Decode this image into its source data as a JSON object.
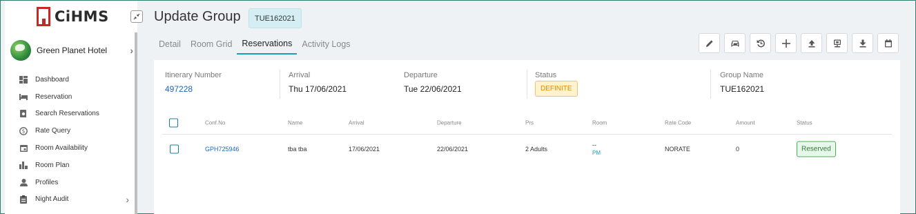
{
  "app": {
    "logo_text": "CiHMS"
  },
  "sidebar": {
    "hotel_name": "Green Planet Hotel",
    "items": [
      {
        "label": "Dashboard",
        "icon": "dashboard-icon"
      },
      {
        "label": "Reservation",
        "icon": "bed-icon"
      },
      {
        "label": "Search Reservations",
        "icon": "search-icon"
      },
      {
        "label": "Rate Query",
        "icon": "dollar-icon"
      },
      {
        "label": "Room Availability",
        "icon": "calendar-icon"
      },
      {
        "label": "Room Plan",
        "icon": "bar-chart-icon"
      },
      {
        "label": "Profiles",
        "icon": "person-icon"
      },
      {
        "label": "Night Audit",
        "icon": "clipboard-icon",
        "has_submenu": true
      }
    ]
  },
  "header": {
    "title": "Update Group",
    "group_code": "TUE162021"
  },
  "tabs": [
    {
      "label": "Detail",
      "active": false
    },
    {
      "label": "Room Grid",
      "active": false
    },
    {
      "label": "Reservations",
      "active": true
    },
    {
      "label": "Activity Logs",
      "active": false
    }
  ],
  "toolbar": [
    {
      "icon": "pencil-icon"
    },
    {
      "icon": "car-icon"
    },
    {
      "icon": "history-icon"
    },
    {
      "icon": "plus-icon"
    },
    {
      "icon": "upload-icon"
    },
    {
      "icon": "monitor-icon"
    },
    {
      "icon": "download-icon"
    },
    {
      "icon": "calendar-icon"
    }
  ],
  "summary": {
    "itinerary_label": "Itinerary Number",
    "itinerary_value": "497228",
    "arrival_label": "Arrival",
    "arrival_value": "Thu 17/06/2021",
    "departure_label": "Departure",
    "departure_value": "Tue 22/06/2021",
    "status_label": "Status",
    "status_value": "DEFINITE",
    "group_name_label": "Group Name",
    "group_name_value": "TUE162021"
  },
  "table": {
    "columns": [
      "Conf.No",
      "Name",
      "Arrival",
      "Departure",
      "Prs",
      "Room",
      "Rate Code",
      "Amount",
      "Status"
    ],
    "rows": [
      {
        "conf_no": "GPH725946",
        "name": "tba tba",
        "arrival": "17/06/2021",
        "departure": "22/06/2021",
        "prs": "2 Adults",
        "room": "--",
        "room_sub": "PM",
        "rate_code": "NORATE",
        "amount": "0",
        "status": "Reserved"
      }
    ]
  },
  "colors": {
    "accent": "#1a9fb0",
    "link": "#1a66c2",
    "definite_text": "#e08a00",
    "reserved_text": "#2e7d32",
    "logo_red": "#c62828"
  }
}
